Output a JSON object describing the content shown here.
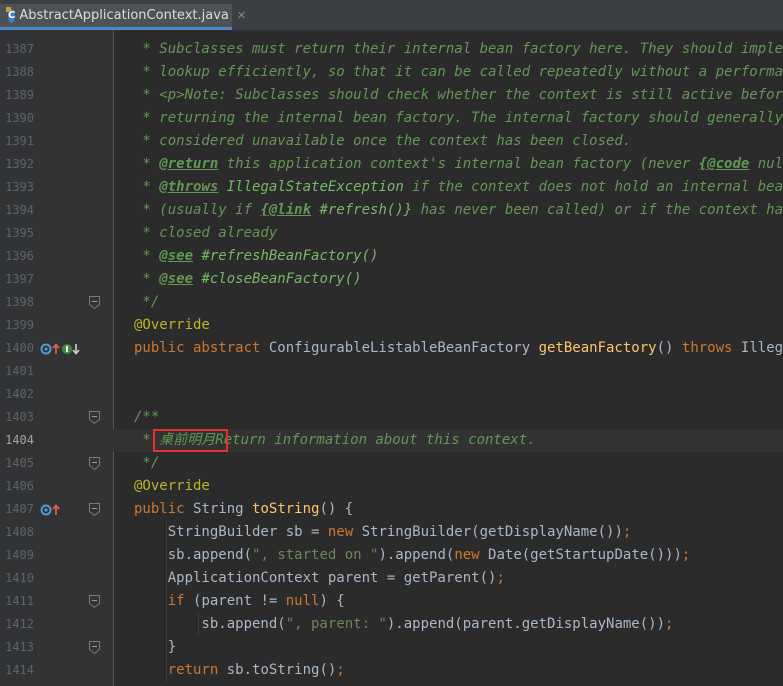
{
  "tab": {
    "filename": "AbstractApplicationContext.java",
    "file_type_letter": "C"
  },
  "highlight_text": "桌前明月",
  "lines": [
    {
      "n": "1387",
      "segs": [
        [
          "doc",
          " * Subclasses must return their internal bean factory here. They should implement the"
        ]
      ]
    },
    {
      "n": "1388",
      "segs": [
        [
          "doc",
          " * lookup efficiently, so that it can be called repeatedly without a performance penalty."
        ]
      ]
    },
    {
      "n": "1389",
      "segs": [
        [
          "doc",
          " * <p>Note: Subclasses should check whether the context is still active before"
        ]
      ]
    },
    {
      "n": "1390",
      "segs": [
        [
          "doc",
          " * returning the internal bean factory. The internal factory should generally be"
        ]
      ]
    },
    {
      "n": "1391",
      "segs": [
        [
          "doc",
          " * considered unavailable once the context has been closed."
        ]
      ]
    },
    {
      "n": "1392",
      "segs": [
        [
          "doc",
          " * "
        ],
        [
          "tag",
          "@return"
        ],
        [
          "doc",
          " this application context's internal bean factory (never "
        ],
        [
          "tag",
          "{@code"
        ],
        [
          "doc",
          " null})"
        ]
      ]
    },
    {
      "n": "1393",
      "segs": [
        [
          "doc",
          " * "
        ],
        [
          "tag",
          "@throws"
        ],
        [
          "ref",
          " IllegalStateException"
        ],
        [
          "doc",
          " if the context does not hold an internal bean factory yet"
        ]
      ]
    },
    {
      "n": "1394",
      "segs": [
        [
          "doc",
          " * (usually if "
        ],
        [
          "tag",
          "{@link"
        ],
        [
          "ref",
          " #refresh()}"
        ],
        [
          "doc",
          " has never been called) or if the context has been"
        ]
      ]
    },
    {
      "n": "1395",
      "segs": [
        [
          "doc",
          " * closed already"
        ]
      ]
    },
    {
      "n": "1396",
      "segs": [
        [
          "doc",
          " * "
        ],
        [
          "tag",
          "@see"
        ],
        [
          "ref",
          " #refreshBeanFactory()"
        ]
      ]
    },
    {
      "n": "1397",
      "segs": [
        [
          "doc",
          " * "
        ],
        [
          "tag",
          "@see"
        ],
        [
          "ref",
          " #closeBeanFactory()"
        ]
      ]
    },
    {
      "n": "1398",
      "segs": [
        [
          "doc",
          " */"
        ]
      ]
    },
    {
      "n": "1399",
      "segs": [
        [
          "ann",
          "@Override"
        ]
      ]
    },
    {
      "n": "1400",
      "segs": [
        [
          "kw",
          "public abstract "
        ],
        [
          "txt",
          "ConfigurableListableBeanFactory "
        ],
        [
          "fn",
          "getBeanFactory"
        ],
        [
          "txt",
          "() "
        ],
        [
          "kw",
          "throws "
        ],
        [
          "txt",
          "IllegalStateException;"
        ]
      ]
    },
    {
      "n": "1401",
      "segs": []
    },
    {
      "n": "1402",
      "segs": []
    },
    {
      "n": "1403",
      "segs": [
        [
          "doc",
          "/**"
        ]
      ]
    },
    {
      "n": "1404",
      "segs": [
        [
          "doc",
          " * 桌前明月Return information about this context."
        ]
      ]
    },
    {
      "n": "1405",
      "segs": [
        [
          "doc",
          " */"
        ]
      ]
    },
    {
      "n": "1406",
      "segs": [
        [
          "ann",
          "@Override"
        ]
      ]
    },
    {
      "n": "1407",
      "segs": [
        [
          "kw",
          "public "
        ],
        [
          "txt",
          "String "
        ],
        [
          "fn",
          "toString"
        ],
        [
          "txt",
          "() {"
        ]
      ]
    },
    {
      "n": "1408",
      "segs": [
        [
          "txt",
          "    StringBuilder sb = "
        ],
        [
          "kw",
          "new "
        ],
        [
          "txt",
          "StringBuilder(getDisplayName())"
        ],
        [
          "kw",
          ";"
        ]
      ]
    },
    {
      "n": "1409",
      "segs": [
        [
          "txt",
          "    sb.append("
        ],
        [
          "str",
          "\", started on \""
        ],
        [
          "txt",
          ").append("
        ],
        [
          "kw",
          "new "
        ],
        [
          "txt",
          "Date(getStartupDate()))"
        ],
        [
          "kw",
          ";"
        ]
      ]
    },
    {
      "n": "1410",
      "segs": [
        [
          "txt",
          "    ApplicationContext parent = getParent()"
        ],
        [
          "kw",
          ";"
        ]
      ]
    },
    {
      "n": "1411",
      "segs": [
        [
          "txt",
          "    "
        ],
        [
          "kw",
          "if "
        ],
        [
          "txt",
          "(parent != "
        ],
        [
          "kw",
          "null"
        ],
        [
          "txt",
          ") {"
        ]
      ]
    },
    {
      "n": "1412",
      "segs": [
        [
          "txt",
          "        sb.append("
        ],
        [
          "str",
          "\", parent: \""
        ],
        [
          "txt",
          ").append(parent.getDisplayName())"
        ],
        [
          "kw",
          ";"
        ]
      ]
    },
    {
      "n": "1413",
      "segs": [
        [
          "txt",
          "    }"
        ]
      ]
    },
    {
      "n": "1414",
      "segs": [
        [
          "txt",
          "    "
        ],
        [
          "kw",
          "return "
        ],
        [
          "txt",
          "sb.toString()"
        ],
        [
          "kw",
          ";"
        ]
      ]
    }
  ],
  "current_line": "1404",
  "fold_lines": [
    "1398",
    "1403",
    "1405",
    "1407",
    "1411",
    "1413"
  ],
  "gutter_markers": [
    {
      "line": "1400",
      "icons": [
        "implemented-icon",
        "implementation-up-icon",
        "implementations-icon",
        "implementations-down-icon"
      ]
    },
    {
      "line": "1407",
      "icons": [
        "overrides-icon",
        "overrides-up-icon"
      ]
    }
  ],
  "colors": {
    "background": "#2b2b2b",
    "gutter": "#313335",
    "doc_comment": "#629755",
    "keyword": "#cc7832",
    "annotation": "#bbb529",
    "method": "#ffc66d",
    "highlight_border": "#e8302c"
  }
}
